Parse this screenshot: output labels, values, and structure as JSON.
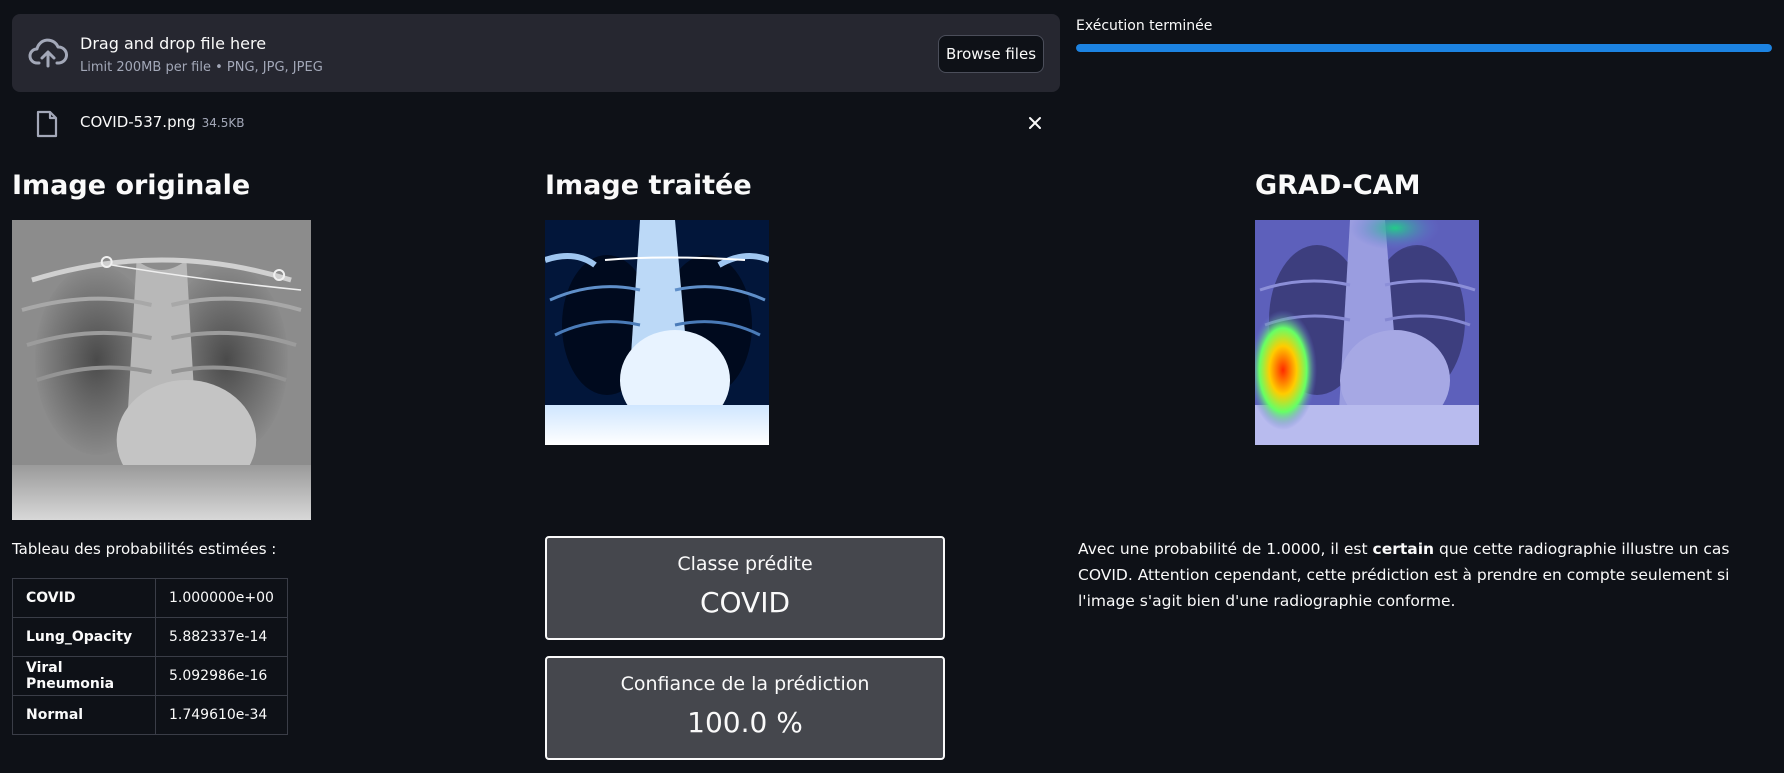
{
  "uploader": {
    "title": "Drag and drop file here",
    "limit": "Limit 200MB per file • PNG, JPG, JPEG",
    "browse_label": "Browse files",
    "icon": "cloud-upload-icon"
  },
  "status": {
    "text": "Exécution terminée",
    "progress": 1.0
  },
  "file": {
    "name": "COVID-537.png",
    "size": "34.5KB",
    "icon": "file-icon"
  },
  "sections": {
    "original": "Image originale",
    "processed": "Image traitée",
    "gradcam": "GRAD-CAM"
  },
  "table": {
    "caption": "Tableau des probabilités estimées :",
    "rows": [
      {
        "label": "COVID",
        "value": "1.000000e+00"
      },
      {
        "label": "Lung_Opacity",
        "value": "5.882337e-14"
      },
      {
        "label": "Viral Pneumonia",
        "value": "5.092986e-16"
      },
      {
        "label": "Normal",
        "value": "1.749610e-34"
      }
    ]
  },
  "prediction": {
    "class_label": "Classe prédite",
    "class_value": "COVID",
    "confidence_label": "Confiance de la prédiction",
    "confidence_value": "100.0 %"
  },
  "explanation": {
    "before": "Avec une probabilité de 1.0000, il est ",
    "bold": "certain",
    "after": " que cette radiographie illustre un cas COVID. Attention cependant, cette prédiction est à prendre en compte seulement si l'image s'agit bien d'une radiographie conforme."
  },
  "colors": {
    "background": "#0e1117",
    "panel": "#262730",
    "accent": "#1c83e1",
    "metric_bg": "#45474d"
  }
}
